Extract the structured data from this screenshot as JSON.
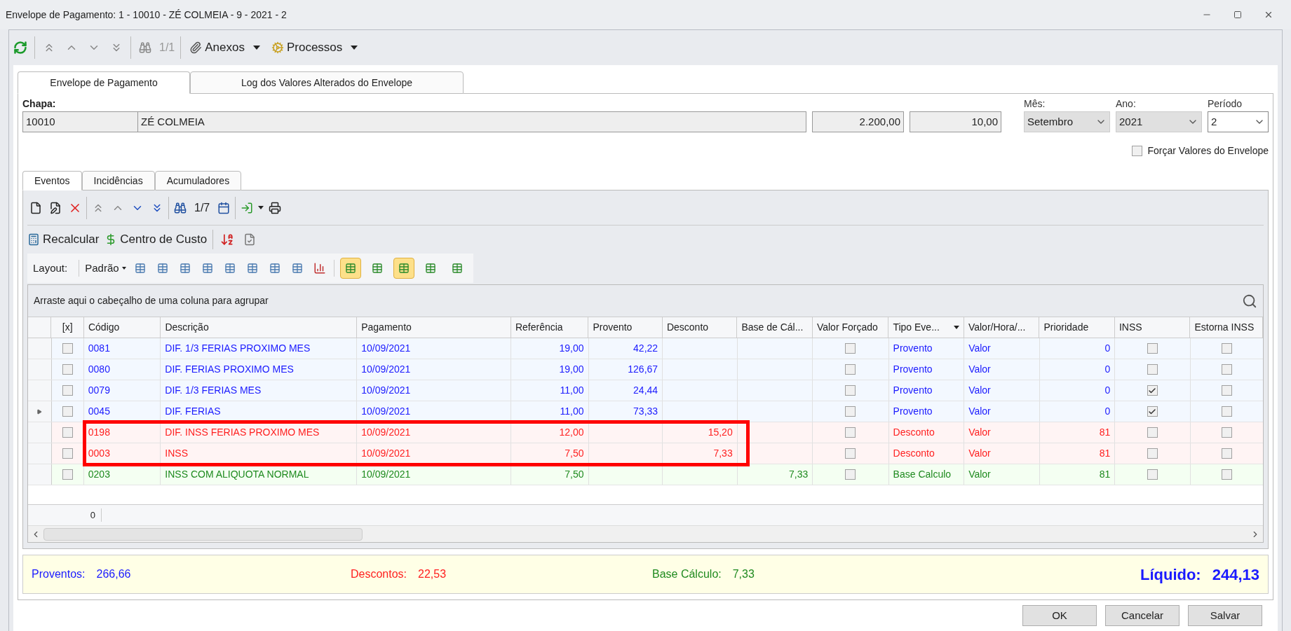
{
  "window": {
    "title": "Envelope de Pagamento: 1 - 10010 - ZÉ COLMEIA - 9 - 2021 - 2"
  },
  "main_toolbar": {
    "record_counter": "1/1",
    "menus": [
      "Anexos",
      "Processos"
    ]
  },
  "tabs": [
    {
      "label": "Envelope de Pagamento",
      "selected": true
    },
    {
      "label": "Log dos Valores Alterados do Envelope",
      "selected": false
    }
  ],
  "header": {
    "chapa_label": "Chapa:",
    "chapa": "10010",
    "name": "ZÉ COLMEIA",
    "salary": "2.200,00",
    "field_4": "10,00",
    "month": {
      "label": "Mês:",
      "value": "Setembro",
      "disabled": true
    },
    "year": {
      "label": "Ano:",
      "value": "2021",
      "disabled": true
    },
    "period": {
      "label": "Período",
      "value": "2",
      "disabled": false
    },
    "force_values": {
      "label": "Forçar Valores do Envelope",
      "checked": false
    }
  },
  "sub_tabs": [
    {
      "label": "Eventos",
      "selected": true
    },
    {
      "label": "Incidências",
      "selected": false
    },
    {
      "label": "Acumuladores",
      "selected": false
    }
  ],
  "events_toolbar": {
    "record_counter": "1/7",
    "actions": [
      "Recalcular",
      "Centro de Custo"
    ]
  },
  "layout_toolbar": {
    "label": "Layout:",
    "preset": "Padrão",
    "view_buttons": [
      {
        "pressed": true
      },
      {
        "pressed": false
      },
      {
        "pressed": true
      },
      {
        "pressed": false
      },
      {
        "pressed": false
      }
    ]
  },
  "group_panel": {
    "hint": "Arraste aqui o cabeçalho de uma coluna para agrupar"
  },
  "table": {
    "columns": [
      "[x]",
      "Código",
      "Descrição",
      "Pagamento",
      "Referência",
      "Provento",
      "Desconto",
      "Base de Cál...",
      "Valor Forçado",
      "Tipo Eve...",
      "Valor/Hora/...",
      "Prioridade",
      "INSS",
      "Estorna INSS"
    ],
    "rows": [
      {
        "kind": "provento",
        "current": false,
        "highlighted": false,
        "x": false,
        "codigo": "0081",
        "descricao": "DIF. 1/3 FERIAS PROXIMO MES",
        "pagamento": "10/09/2021",
        "referencia": "19,00",
        "provento": "42,22",
        "desconto": "",
        "base": "",
        "valor_forcado": false,
        "tipo": "Provento",
        "valor_hora": "Valor",
        "prioridade": "0",
        "inss": false,
        "estorna_inss": false
      },
      {
        "kind": "provento",
        "current": false,
        "highlighted": false,
        "x": false,
        "codigo": "0080",
        "descricao": "DIF. FERIAS PROXIMO MES",
        "pagamento": "10/09/2021",
        "referencia": "19,00",
        "provento": "126,67",
        "desconto": "",
        "base": "",
        "valor_forcado": false,
        "tipo": "Provento",
        "valor_hora": "Valor",
        "prioridade": "0",
        "inss": false,
        "estorna_inss": false
      },
      {
        "kind": "provento",
        "current": false,
        "highlighted": false,
        "x": false,
        "codigo": "0079",
        "descricao": "DIF. 1/3 FERIAS MES",
        "pagamento": "10/09/2021",
        "referencia": "11,00",
        "provento": "24,44",
        "desconto": "",
        "base": "",
        "valor_forcado": false,
        "tipo": "Provento",
        "valor_hora": "Valor",
        "prioridade": "0",
        "inss": true,
        "estorna_inss": false
      },
      {
        "kind": "provento",
        "current": true,
        "highlighted": false,
        "x": false,
        "codigo": "0045",
        "descricao": "DIF. FERIAS",
        "pagamento": "10/09/2021",
        "referencia": "11,00",
        "provento": "73,33",
        "desconto": "",
        "base": "",
        "valor_forcado": false,
        "tipo": "Provento",
        "valor_hora": "Valor",
        "prioridade": "0",
        "inss": true,
        "estorna_inss": false
      },
      {
        "kind": "desconto",
        "current": false,
        "highlighted": true,
        "x": false,
        "codigo": "0198",
        "descricao": "DIF. INSS FERIAS PROXIMO MES",
        "pagamento": "10/09/2021",
        "referencia": "12,00",
        "provento": "",
        "desconto": "15,20",
        "base": "",
        "valor_forcado": false,
        "tipo": "Desconto",
        "valor_hora": "Valor",
        "prioridade": "81",
        "inss": false,
        "estorna_inss": false
      },
      {
        "kind": "desconto",
        "current": false,
        "highlighted": true,
        "x": false,
        "codigo": "0003",
        "descricao": "INSS",
        "pagamento": "10/09/2021",
        "referencia": "7,50",
        "provento": "",
        "desconto": "7,33",
        "base": "",
        "valor_forcado": false,
        "tipo": "Desconto",
        "valor_hora": "Valor",
        "prioridade": "81",
        "inss": false,
        "estorna_inss": false
      },
      {
        "kind": "base",
        "current": false,
        "highlighted": false,
        "x": false,
        "codigo": "0203",
        "descricao": "INSS COM ALIQUOTA NORMAL",
        "pagamento": "10/09/2021",
        "referencia": "7,50",
        "provento": "",
        "desconto": "",
        "base": "7,33",
        "valor_forcado": false,
        "tipo": "Base Calculo",
        "valor_hora": "Valor",
        "prioridade": "81",
        "inss": false,
        "estorna_inss": false
      }
    ],
    "footer_count": "0"
  },
  "totals": [
    {
      "kind": "provento",
      "label": "Proventos:",
      "value": "266,66"
    },
    {
      "kind": "desconto",
      "label": "Descontos:",
      "value": "22,53"
    },
    {
      "kind": "base",
      "label": "Base Cálculo:",
      "value": "7,33"
    },
    {
      "kind": "liquido",
      "label": "Líquido:",
      "value": "244,13"
    }
  ],
  "buttons": [
    "OK",
    "Cancelar",
    "Salvar"
  ]
}
